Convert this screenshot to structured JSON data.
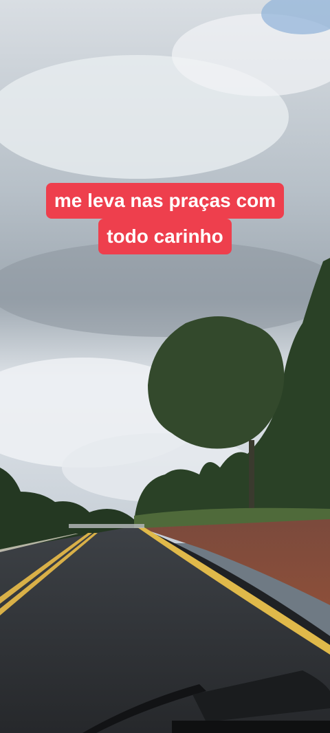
{
  "overlay": {
    "caption_lines": [
      "me leva nas praças com",
      "todo carinho"
    ],
    "caption_background": "#ee3f4d",
    "caption_text_color": "#ffffff"
  },
  "scene": {
    "description_colors": {
      "sky": "#c9d0d6",
      "road": "#2f3236",
      "lane_line": "#e0b94a",
      "dirt": "#8a4a38",
      "trees": "#2c4228"
    }
  }
}
